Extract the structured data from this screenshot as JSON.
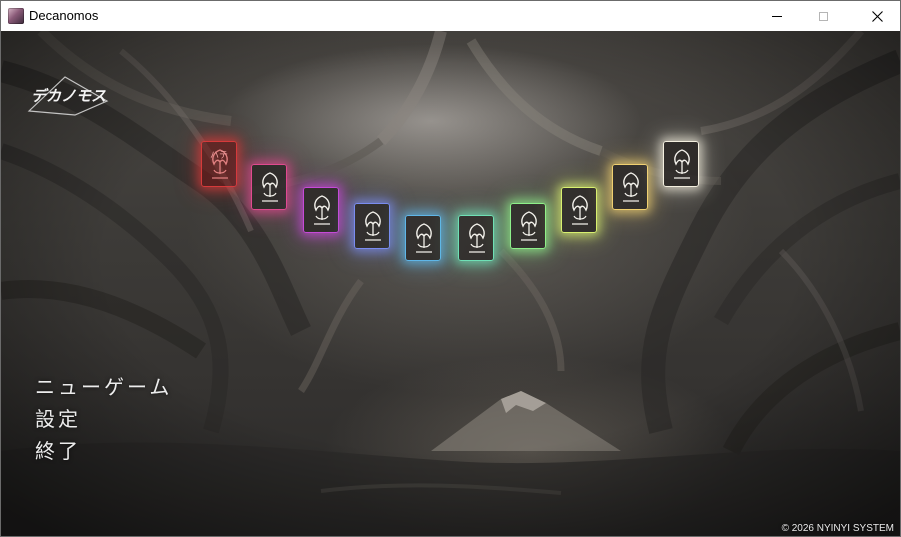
{
  "window": {
    "title": "Decanomos",
    "icon": "app-icon",
    "controls": [
      {
        "name": "minimize",
        "glyph": "—"
      },
      {
        "name": "maximize",
        "glyph": "☐"
      },
      {
        "name": "close",
        "glyph": "✕"
      }
    ]
  },
  "game": {
    "logo_text": "デカノモス",
    "cards": [
      {
        "glow": "#d63a3a",
        "mark": "ハテ"
      },
      {
        "glow": "#e04a8f",
        "mark": ""
      },
      {
        "glow": "#c64ad8",
        "mark": ""
      },
      {
        "glow": "#7a8cf0",
        "mark": ""
      },
      {
        "glow": "#5fb6e8",
        "mark": ""
      },
      {
        "glow": "#6fe0b6",
        "mark": ""
      },
      {
        "glow": "#8ef08a",
        "mark": ""
      },
      {
        "glow": "#d8f070",
        "mark": ""
      },
      {
        "glow": "#f0d070",
        "mark": ""
      },
      {
        "glow": "#f4f0e0",
        "mark": ""
      }
    ],
    "menu": [
      {
        "label": "ニューゲーム"
      },
      {
        "label": "設定"
      },
      {
        "label": "終了"
      }
    ],
    "copyright": "© 2026 NYINYI SYSTEM"
  }
}
